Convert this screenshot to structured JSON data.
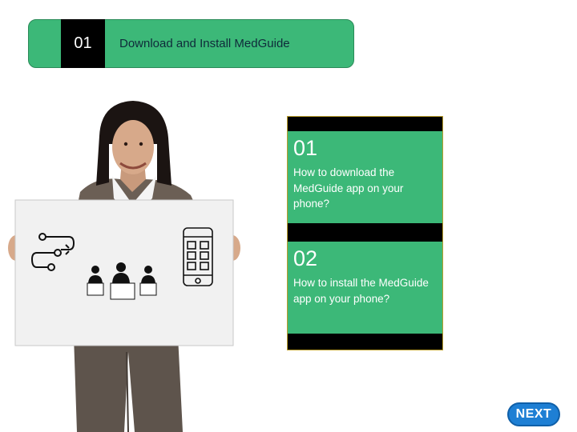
{
  "header": {
    "number": "01",
    "title": "Download and Install MedGuide"
  },
  "topics": [
    {
      "number": "01",
      "text": "How to download the MedGuide app on your phone?"
    },
    {
      "number": "02",
      "text": "How to install the MedGuide app on your phone?"
    }
  ],
  "navigation": {
    "next_label": "NEXT"
  },
  "colors": {
    "accent_green": "#3cb878",
    "dark": "#000000",
    "next_button": "#1e7fd4"
  },
  "illustration": {
    "icons": [
      "workflow-icon",
      "team-icon",
      "smartphone-icon"
    ]
  }
}
